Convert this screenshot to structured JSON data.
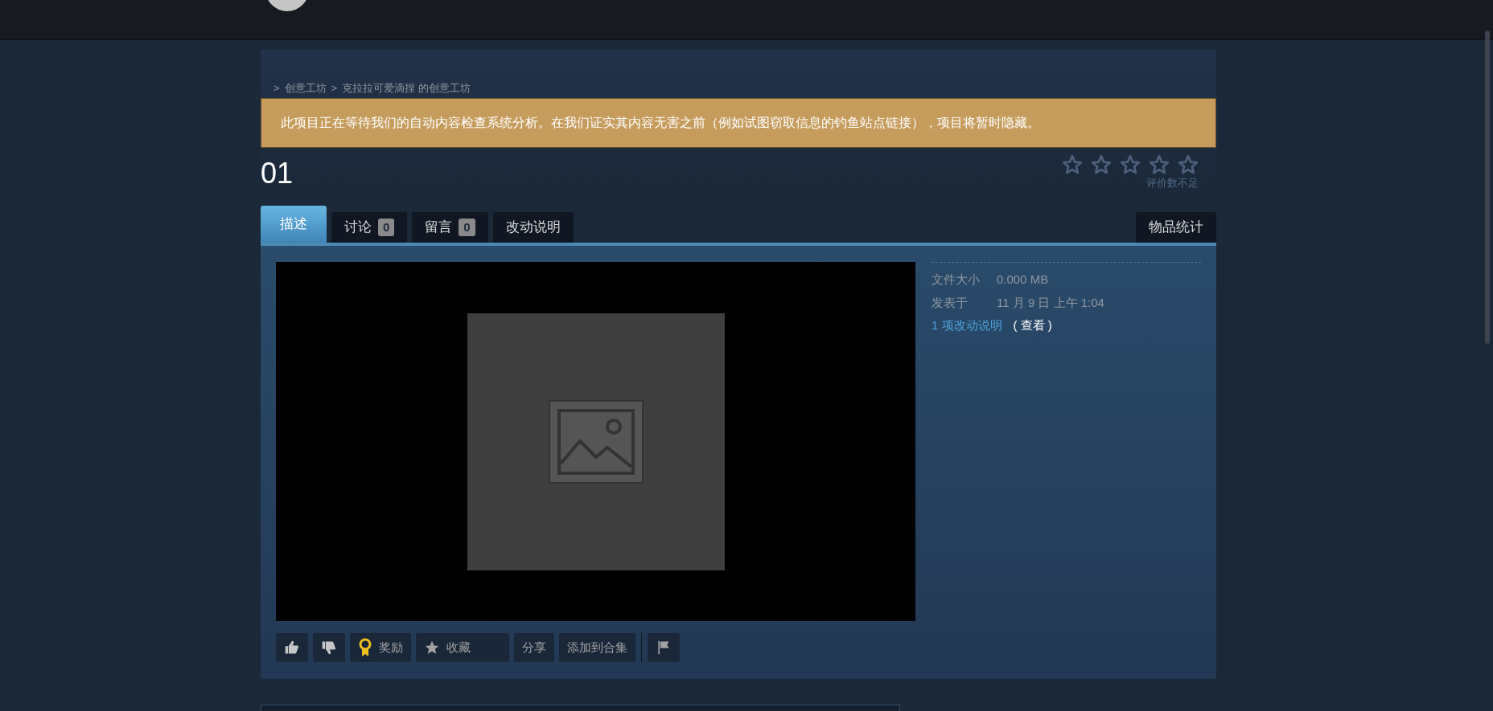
{
  "breadcrumb": [
    {
      "separator": ">",
      "label": "创意工坊"
    },
    {
      "separator": ">",
      "label": "克拉拉可爱滴捏 的创意工坊"
    }
  ],
  "notice": "此项目正在等待我们的自动内容检查系统分析。在我们证实其内容无害之前（例如试图窃取信息的钓鱼站点链接），项目将暂时隐藏。",
  "title": "01",
  "rating": {
    "stars": 0,
    "caption": "评价数不足"
  },
  "tabs": [
    {
      "label": "描述",
      "selected": true
    },
    {
      "label": "讨论",
      "count": "0",
      "selected": false
    },
    {
      "label": "留言",
      "count": "0",
      "selected": false
    },
    {
      "label": "改动说明",
      "selected": false
    }
  ],
  "stats_tab": {
    "label": "物品统计",
    "selected": false
  },
  "details": [
    {
      "label": "文件大小",
      "value": "0.000 MB"
    },
    {
      "label": "发表于",
      "value": "11 月 9 日 上午 1:04"
    }
  ],
  "change_notes": {
    "link": "1 项改动说明",
    "action": "( 查看 )"
  },
  "actions": [
    {
      "kind": "thumbs-up"
    },
    {
      "kind": "thumbs-down"
    },
    {
      "kind": "award",
      "label": "奖励"
    },
    {
      "kind": "favorite",
      "label": "收藏"
    },
    {
      "kind": "text",
      "label": "分享"
    },
    {
      "kind": "text",
      "label": "添加到合集"
    },
    {
      "kind": "flag"
    }
  ]
}
